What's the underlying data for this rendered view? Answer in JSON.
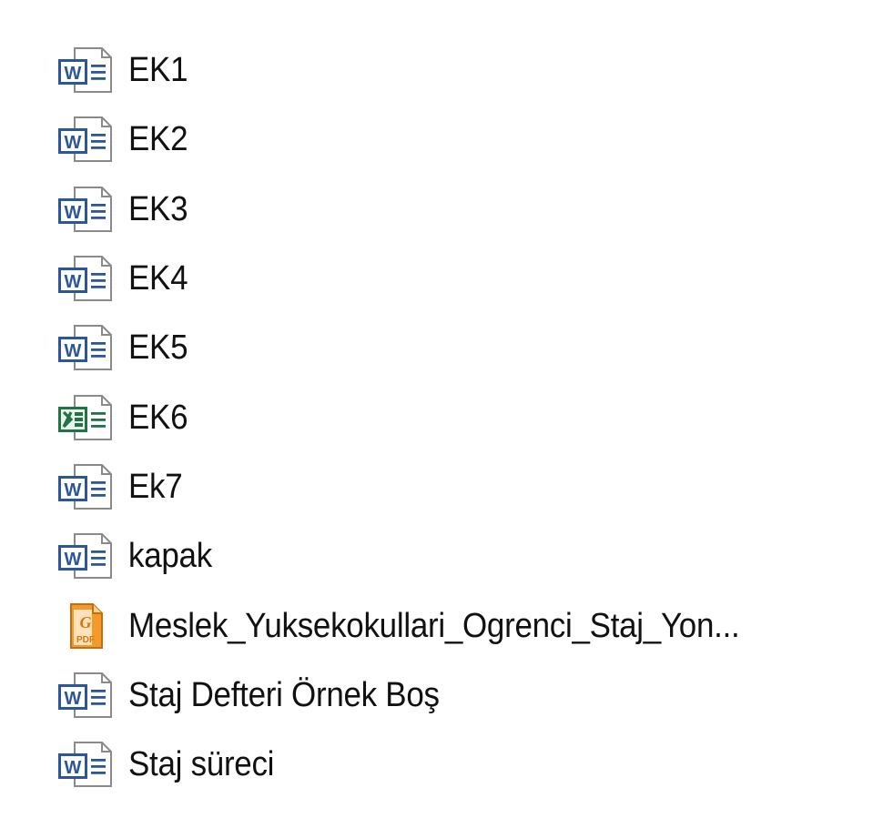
{
  "files": [
    {
      "name": "EK1",
      "icon": "word-doc-icon"
    },
    {
      "name": "EK2",
      "icon": "word-doc-icon"
    },
    {
      "name": "EK3",
      "icon": "word-doc-icon"
    },
    {
      "name": "EK4",
      "icon": "word-doc-icon"
    },
    {
      "name": "EK5",
      "icon": "word-doc-icon"
    },
    {
      "name": "EK6",
      "icon": "excel-sheet-icon"
    },
    {
      "name": "Ek7",
      "icon": "word-doc-icon"
    },
    {
      "name": "kapak",
      "icon": "word-doc-icon"
    },
    {
      "name": "Meslek_Yuksekokullari_Ogrenci_Staj_Yon...",
      "icon": "pdf-icon"
    },
    {
      "name": "Staj Defteri Örnek Boş",
      "icon": "word-doc-icon"
    },
    {
      "name": "Staj süreci",
      "icon": "word-doc-icon"
    }
  ],
  "colors": {
    "word_blue": "#2b579a",
    "excel_green": "#217346",
    "pdf_orange": "#f08a1c",
    "page_border": "#8a8a8a",
    "text": "#111111"
  }
}
